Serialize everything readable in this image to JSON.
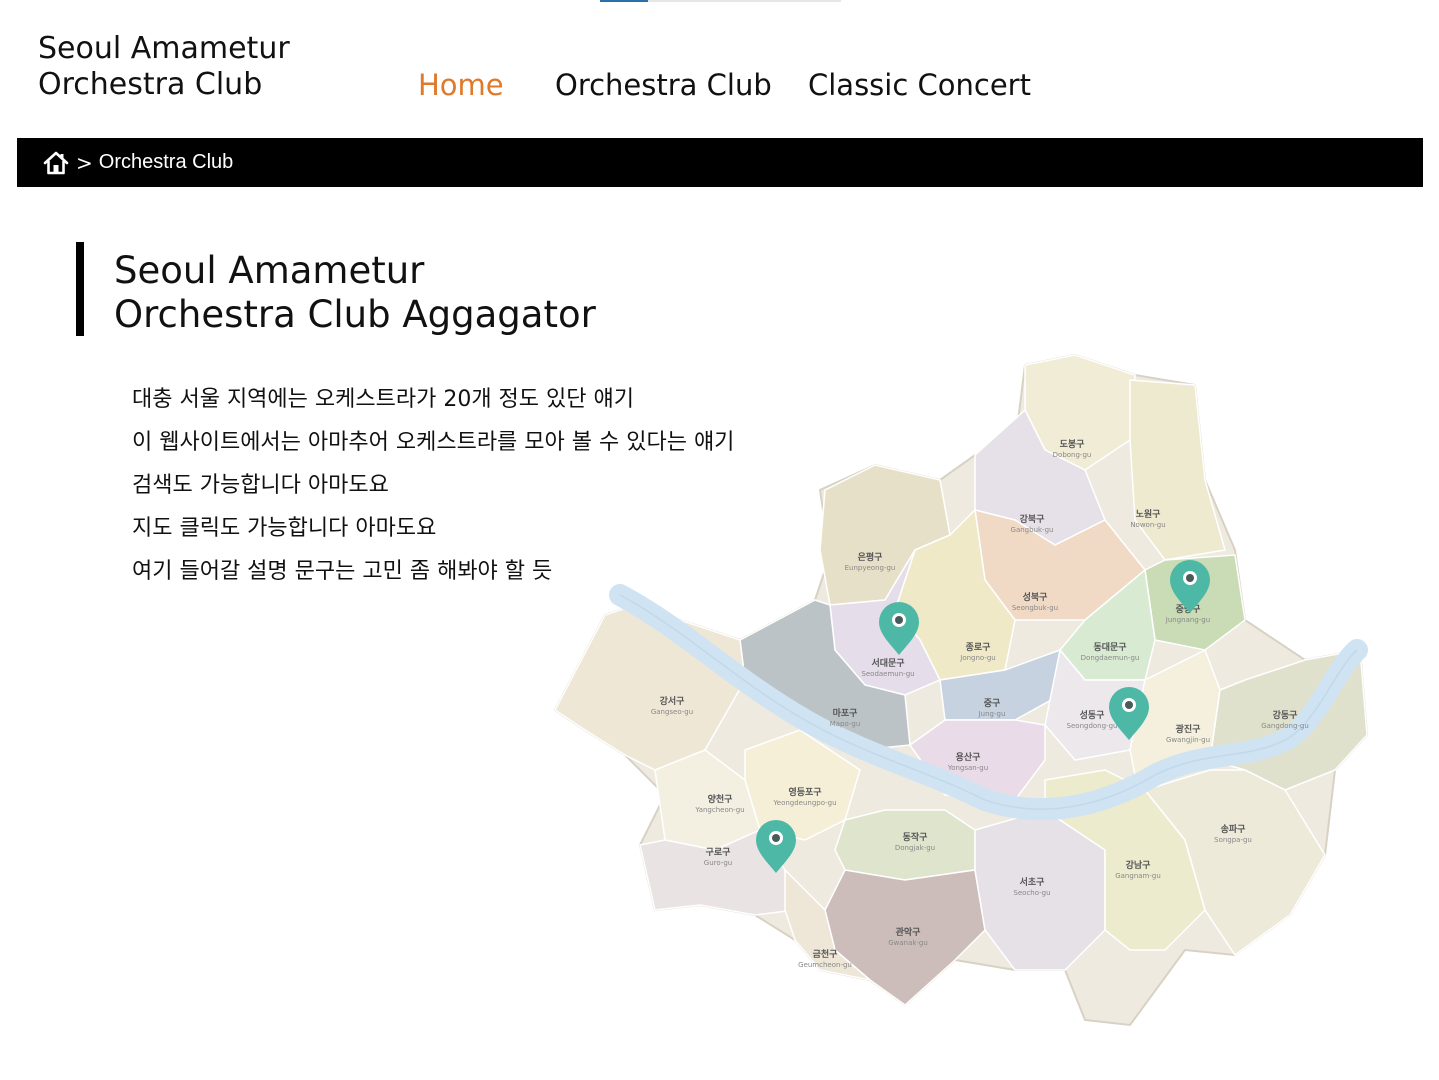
{
  "header": {
    "logo_line1": "Seoul Amametur",
    "logo_line2": "Orchestra Club"
  },
  "nav": {
    "items": [
      {
        "label": "Home",
        "active": true
      },
      {
        "label": "Orchestra Club",
        "active": false
      },
      {
        "label": "Classic Concert",
        "active": false
      }
    ],
    "active_color": "#e07a2b"
  },
  "breadcrumb": {
    "home_icon": "home-icon",
    "separator": ">",
    "current": "Orchestra Club"
  },
  "section": {
    "title_line1": "Seoul Amametur",
    "title_line2": "Orchestra Club Aggagator"
  },
  "description": [
    "대충 서울 지역에는 오케스트라가 20개 정도 있단 얘기",
    "이 웹사이트에서는 아마추어 오케스트라를 모아 볼 수 있다는 얘기",
    "검색도 가능합니다 아마도요",
    "지도 클릭도 가능합니다 아마도요",
    "여기 들어갈 설명 문구는 고민 좀 해봐야 할 듯"
  ],
  "map": {
    "districts": [
      {
        "ko": "도봉구",
        "en": "Dobong-gu"
      },
      {
        "ko": "노원구",
        "en": "Nowon-gu"
      },
      {
        "ko": "강북구",
        "en": "Gangbuk-gu"
      },
      {
        "ko": "은평구",
        "en": "Eunpyeong-gu"
      },
      {
        "ko": "성북구",
        "en": "Seongbuk-gu"
      },
      {
        "ko": "중랑구",
        "en": "Jungnang-gu"
      },
      {
        "ko": "종로구",
        "en": "Jongno-gu"
      },
      {
        "ko": "서대문구",
        "en": "Seodaemun-gu"
      },
      {
        "ko": "동대문구",
        "en": "Dongdaemun-gu"
      },
      {
        "ko": "강서구",
        "en": "Gangseo-gu"
      },
      {
        "ko": "마포구",
        "en": "Mapo-gu"
      },
      {
        "ko": "중구",
        "en": "Jung-gu"
      },
      {
        "ko": "성동구",
        "en": "Seongdong-gu"
      },
      {
        "ko": "광진구",
        "en": "Gwangjin-gu"
      },
      {
        "ko": "강동구",
        "en": "Gangdong-gu"
      },
      {
        "ko": "용산구",
        "en": "Yongsan-gu"
      },
      {
        "ko": "영등포구",
        "en": "Yeongdeungpo-gu"
      },
      {
        "ko": "양천구",
        "en": "Yangcheon-gu"
      },
      {
        "ko": "구로구",
        "en": "Guro-gu"
      },
      {
        "ko": "동작구",
        "en": "Dongjak-gu"
      },
      {
        "ko": "송파구",
        "en": "Songpa-gu"
      },
      {
        "ko": "강남구",
        "en": "Gangnam-gu"
      },
      {
        "ko": "서초구",
        "en": "Seocho-gu"
      },
      {
        "ko": "관악구",
        "en": "Gwanak-gu"
      },
      {
        "ko": "금천구",
        "en": "Geumcheon-gu"
      }
    ],
    "pin_color": "#4db8a6",
    "river_color": "#cfe3f2"
  }
}
